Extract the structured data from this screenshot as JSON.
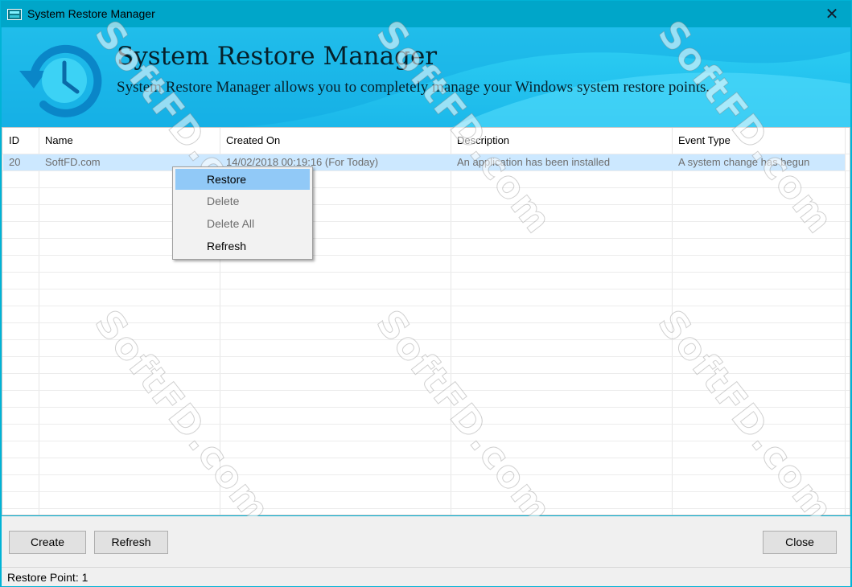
{
  "window": {
    "title": "System Restore Manager",
    "close_glyph": "✕",
    "icon": "app-window-icon"
  },
  "header": {
    "title": "System Restore Manager",
    "subtitle": "System Restore Manager allows you to completely manage your Windows system restore points.",
    "icon": "clock-restore-icon"
  },
  "table": {
    "columns": [
      "ID",
      "Name",
      "Created On",
      "Description",
      "Event Type"
    ],
    "rows": [
      {
        "id": "20",
        "name": "SoftFD.com",
        "created_on": "14/02/2018 00:19:16 (For Today)",
        "description": "An application has been installed",
        "event_type": "A system change has begun"
      }
    ]
  },
  "context_menu": {
    "items": [
      {
        "label": "Restore",
        "state": "highlighted"
      },
      {
        "label": "Delete",
        "state": "disabled"
      },
      {
        "label": "Delete All",
        "state": "disabled"
      },
      {
        "label": "Refresh",
        "state": "enabled"
      }
    ]
  },
  "buttons": {
    "create": "Create",
    "refresh": "Refresh",
    "close": "Close"
  },
  "status": {
    "text": "Restore Point: 1"
  },
  "watermark": {
    "text": "SoftFD.com"
  },
  "colors": {
    "titlebar": "#00a6c9",
    "header": "#2fd0f4",
    "selection": "#cce8ff",
    "menu_highlight": "#91c9f7"
  }
}
